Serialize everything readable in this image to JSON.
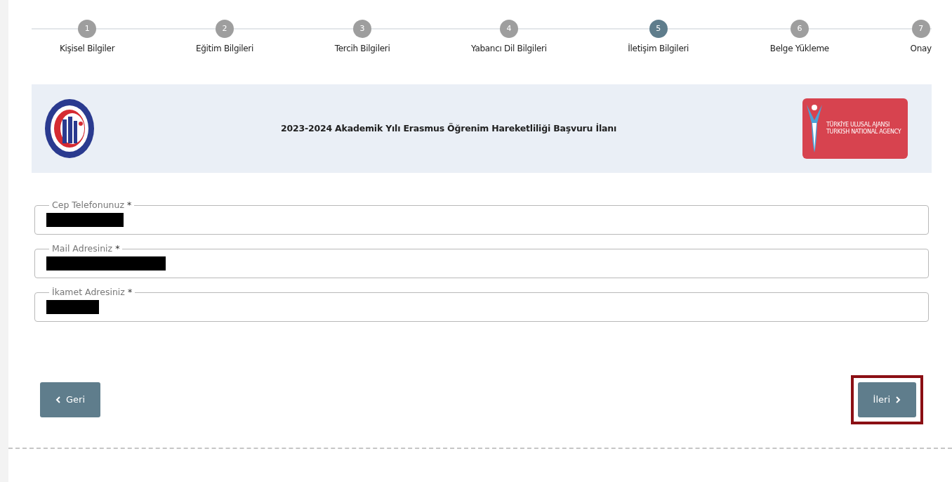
{
  "steps": [
    {
      "number": "1",
      "label": "Kişisel Bilgiler",
      "selected": false
    },
    {
      "number": "2",
      "label": "Eğitim Bilgileri",
      "selected": false
    },
    {
      "number": "3",
      "label": "Tercih Bilgileri",
      "selected": false
    },
    {
      "number": "4",
      "label": "Yabancı Dil Bilgileri",
      "selected": false
    },
    {
      "number": "5",
      "label": "İletişim Bilgileri",
      "selected": true
    },
    {
      "number": "6",
      "label": "Belge Yükleme",
      "selected": false
    },
    {
      "number": "7",
      "label": "Onay",
      "selected": false
    }
  ],
  "banner": {
    "title": "2023-2024 Akademik Yılı Erasmus Öğrenim Hareketliliği Başvuru İlanı",
    "agency_logo": {
      "line_1": "TÜRKİYE ULUSAL AJANSI",
      "line_2": "TURKISH NATIONAL AGENCY"
    }
  },
  "fields": [
    {
      "label": "Cep Telefonunuz",
      "required": "*",
      "redacted": true
    },
    {
      "label": "Mail Adresiniz",
      "required": "*",
      "redacted": true
    },
    {
      "label": "İkamet Adresiniz",
      "required": "*",
      "redacted": true
    }
  ],
  "buttons": [
    {
      "kind": "back",
      "label": "Geri",
      "highlighted": false
    },
    {
      "kind": "next",
      "label": "İleri",
      "highlighted": true
    }
  ]
}
